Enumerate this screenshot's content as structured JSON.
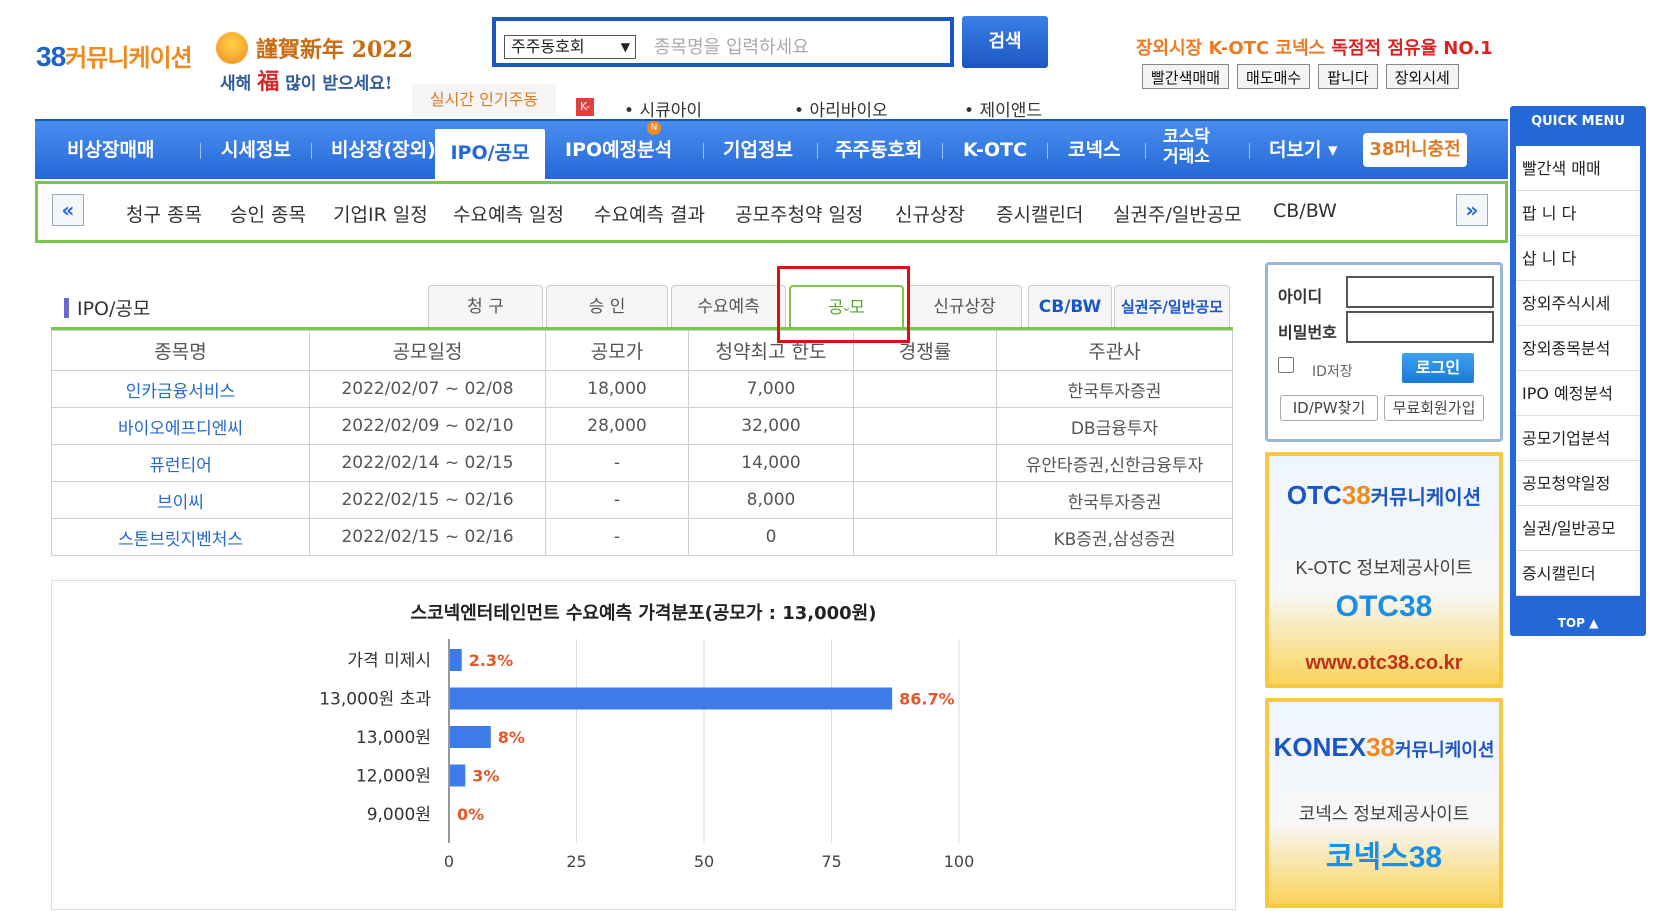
{
  "header": {
    "logo_num": "38",
    "logo_text": "커뮤니케이션",
    "newyear_title": "謹賀新年 2022",
    "newyear_sub_a": "새해",
    "newyear_sub_b": "福",
    "newyear_sub_c": "많이 받으세요!",
    "search_select": "주주동호회",
    "search_placeholder": "종목명을 입력하세요",
    "search_button": "검색",
    "tagline_a": "장외시장 K-OTC 코넥스",
    "tagline_b": "독점적 점유율 NO.1",
    "top_links": [
      "빨간색매매",
      "매도매수",
      "팝니다",
      "장외시세"
    ],
    "realtime_label": "실시간 인기주동",
    "realtime_badge": "K-",
    "realtime_items": [
      "시큐아이",
      "아리바이오",
      "제이앤드"
    ]
  },
  "mainnav": {
    "items": [
      "비상장매매",
      "시세정보",
      "비상장(장외)",
      "IPO/공모",
      "IPO예정분석",
      "기업정보",
      "주주동호회",
      "K-OTC",
      "코넥스",
      "코스닥\n거래소",
      "더보기 ▾",
      "38머니충전"
    ],
    "active": "IPO/공모",
    "new_badge": "N"
  },
  "subnav": {
    "prev": "«",
    "next": "»",
    "items": [
      "청구 종목",
      "승인 종목",
      "기업IR 일정",
      "수요예측 일정",
      "수요예측 결과",
      "공모주청약 일정",
      "신규상장",
      "증시캘린더",
      "실권주/일반공모",
      "CB/BW"
    ]
  },
  "section": {
    "title": "IPO/공모",
    "tabs": [
      "청 구",
      "승 인",
      "수요예측",
      "공 모",
      "신규상장",
      "CB/BW",
      "실권주/일반공모"
    ],
    "active_tab": "공 모",
    "tab_caret": "⌄"
  },
  "table": {
    "headers": [
      "종목명",
      "공모일정",
      "공모가",
      "청약최고 한도",
      "경쟁률",
      "주관사"
    ],
    "rows": [
      [
        "인카금융서비스",
        "2022/02/07 ~ 02/08",
        "18,000",
        "7,000",
        "",
        "한국투자증권"
      ],
      [
        "바이오에프디엔씨",
        "2022/02/09 ~ 02/10",
        "28,000",
        "32,000",
        "",
        "DB금융투자"
      ],
      [
        "퓨런티어",
        "2022/02/14 ~ 02/15",
        "-",
        "14,000",
        "",
        "유안타증권,신한금융투자"
      ],
      [
        "브이씨",
        "2022/02/15 ~ 02/16",
        "-",
        "8,000",
        "",
        "한국투자증권"
      ],
      [
        "스톤브릿지벤처스",
        "2022/02/15 ~ 02/16",
        "-",
        "0",
        "",
        "KB증권,삼성증권"
      ]
    ]
  },
  "chart_data": {
    "type": "bar",
    "orientation": "horizontal",
    "title": "스코넥엔터테인먼트 수요예측 가격분포(공모가 : 13,000원)",
    "categories": [
      "가격 미제시",
      "13,000원 초과",
      "13,000원",
      "12,000원",
      "9,000원"
    ],
    "values": [
      2.3,
      86.7,
      8,
      3,
      0
    ],
    "value_labels": [
      "2.3%",
      "86.7%",
      "8%",
      "3%",
      "0%"
    ],
    "xlim": [
      0,
      100
    ],
    "xticks": [
      0,
      25,
      50,
      75,
      100
    ],
    "bar_color": "#3d7ce8",
    "label_color": "#e0582a",
    "grid": true
  },
  "login": {
    "id_label": "아이디",
    "pw_label": "비밀번호",
    "save_label": "ID저장",
    "login_button": "로그인",
    "find_button": "ID/PW찾기",
    "join_button": "무료회원가입"
  },
  "banner_otc": {
    "logo_a": "OTC",
    "logo_b": "38",
    "logo_c": "커뮤니케이션",
    "desc": "K-OTC 정보제공사이트",
    "name": "OTC38",
    "url": "www.otc38.co.kr"
  },
  "banner_konex": {
    "logo_a": "KONEX",
    "logo_b": "38",
    "logo_c": "커뮤니케이션",
    "desc": "코넥스 정보제공사이트",
    "name": "코넥스38"
  },
  "quick": {
    "title": "QUICK MENU",
    "items": [
      "빨간색 매매",
      "팝 니 다",
      "삽 니 다",
      "장외주식시세",
      "장외종목분석",
      "IPO 예정분석",
      "공모기업분석",
      "공모청약일정",
      "실권/일반공모",
      "증시캘린더"
    ],
    "top": "TOP ▲"
  }
}
